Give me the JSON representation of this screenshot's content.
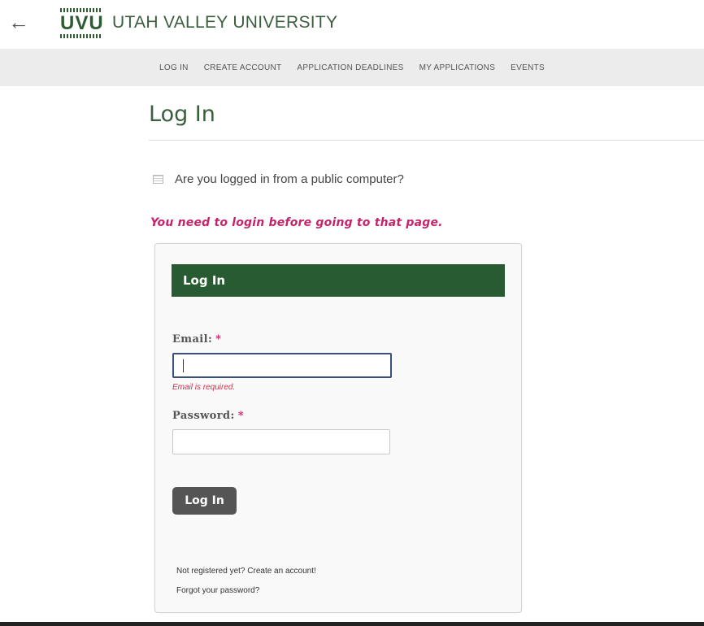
{
  "header": {
    "back_icon": "←",
    "logo_text": "UVU",
    "university_name": "UTAH VALLEY UNIVERSITY"
  },
  "nav": {
    "items": [
      {
        "label": "LOG IN"
      },
      {
        "label": "CREATE ACCOUNT"
      },
      {
        "label": "APPLICATION DEADLINES"
      },
      {
        "label": "MY APPLICATIONS"
      },
      {
        "label": "EVENTS"
      }
    ]
  },
  "page": {
    "title": "Log In",
    "public_computer_label": "Are you logged in from a public computer?",
    "alert_message": "You need to login before going to that page."
  },
  "login_form": {
    "header_title": "Log In",
    "email_label": "Email:",
    "password_label": "Password:",
    "required_marker": "*",
    "email_value": "",
    "password_value": "",
    "email_error": "Email is required.",
    "submit_label": "Log In",
    "register_link": "Not registered yet? Create an account!",
    "forgot_link": "Forgot your password?"
  },
  "colors": {
    "brand_green": "#285b31",
    "alert_pink": "#c4256a",
    "nav_bg": "#ececec",
    "button_gray": "#555555"
  }
}
